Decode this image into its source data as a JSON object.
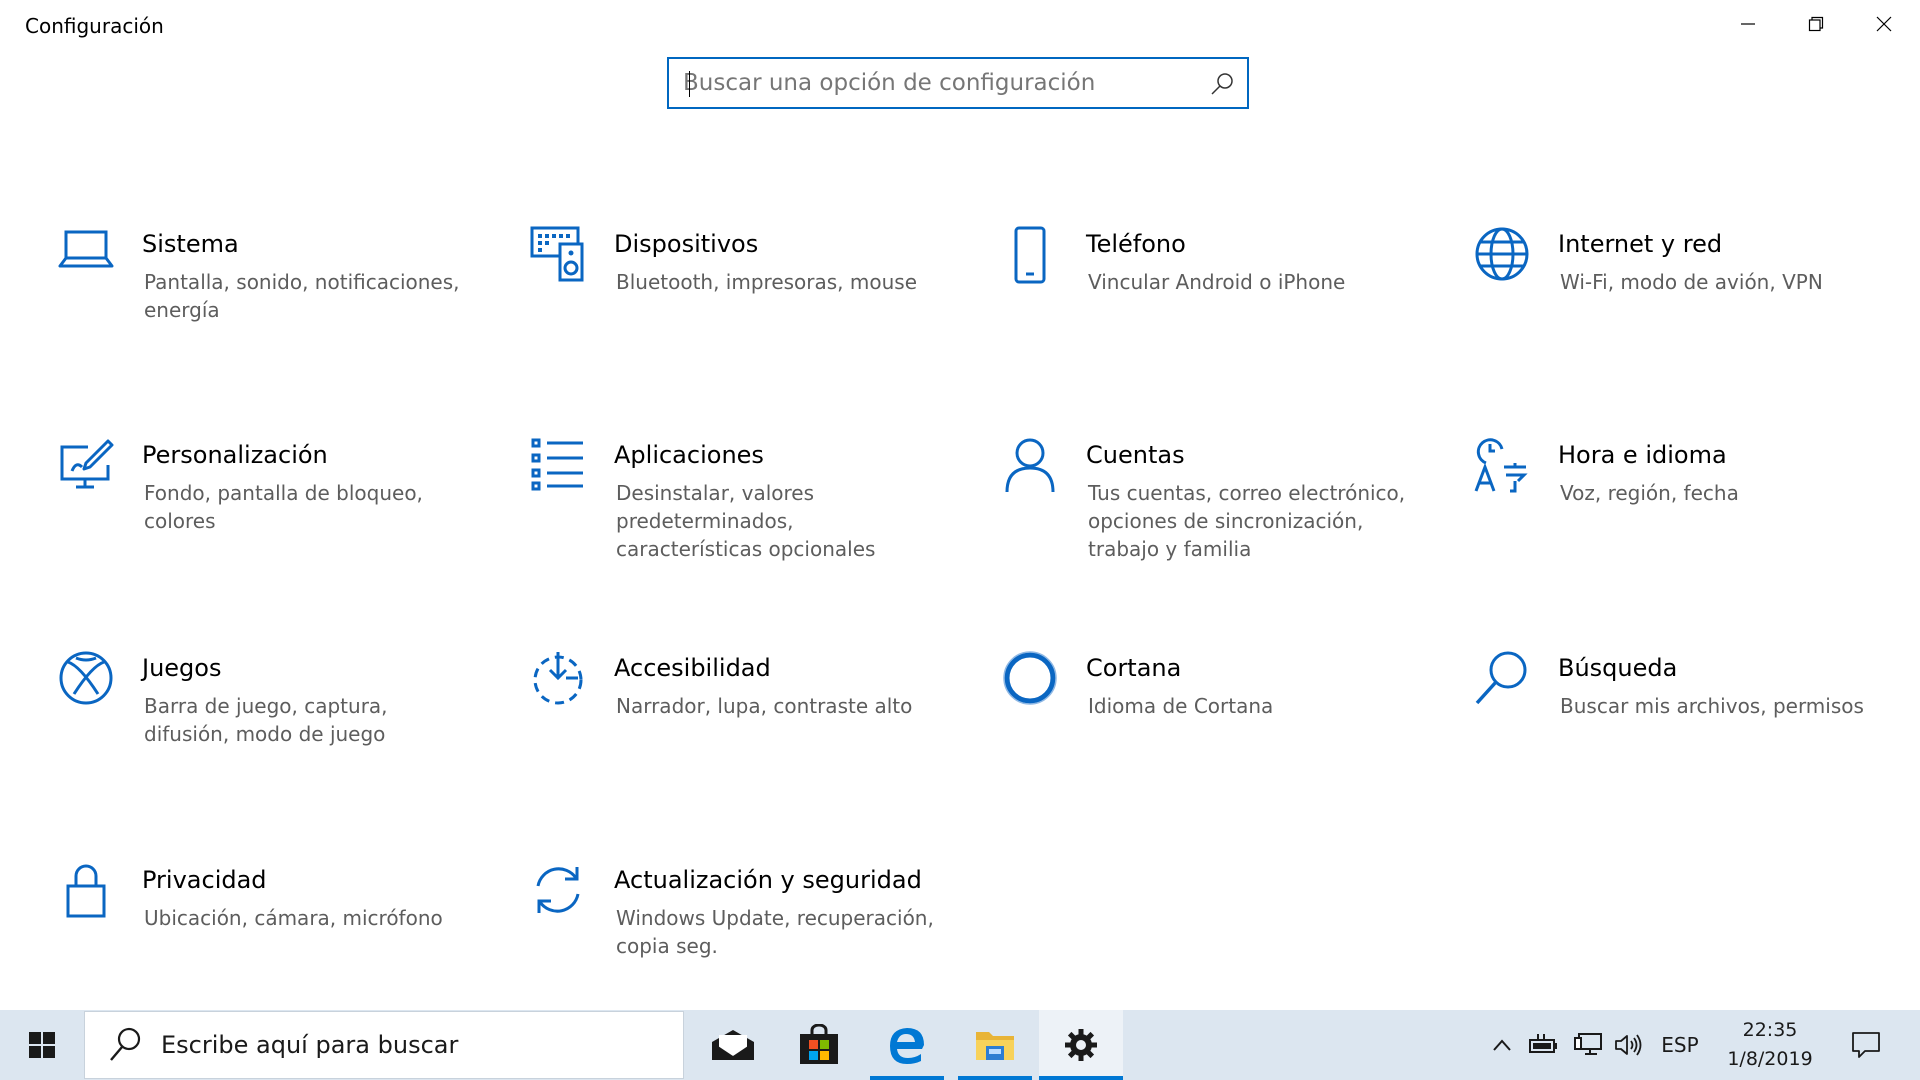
{
  "window": {
    "title": "Configuración",
    "controls": [
      "minimize-icon",
      "restore-icon",
      "close-icon"
    ]
  },
  "search": {
    "placeholder": "Buscar una opción de configuración",
    "value": "",
    "icon": "search-icon"
  },
  "colors": {
    "accent": "#0067c0",
    "icon_blue": "#0a66c2",
    "taskbar": "#dce6f0",
    "description": "#5d5d5d"
  },
  "categories": [
    {
      "title": "Sistema",
      "desc": "Pantalla, sonido, notificaciones, energía",
      "icon": "laptop-icon"
    },
    {
      "title": "Dispositivos",
      "desc": "Bluetooth, impresoras, mouse",
      "icon": "devices-icon"
    },
    {
      "title": "Teléfono",
      "desc": "Vincular Android o iPhone",
      "icon": "phone-icon"
    },
    {
      "title": "Internet y red",
      "desc": "Wi-Fi, modo de avión, VPN",
      "icon": "globe-icon"
    },
    {
      "title": "Personalización",
      "desc": "Fondo, pantalla de bloqueo, colores",
      "icon": "personalization-icon"
    },
    {
      "title": "Aplicaciones",
      "desc": "Desinstalar, valores predeterminados, características opcionales",
      "icon": "apps-list-icon"
    },
    {
      "title": "Cuentas",
      "desc": "Tus cuentas, correo electrónico, opciones de sincronización, trabajo y familia",
      "icon": "person-icon"
    },
    {
      "title": "Hora e idioma",
      "desc": "Voz, región, fecha",
      "icon": "time-language-icon"
    },
    {
      "title": "Juegos",
      "desc": "Barra de juego, captura, difusión, modo de juego",
      "icon": "xbox-icon"
    },
    {
      "title": "Accesibilidad",
      "desc": "Narrador, lupa, contraste alto",
      "icon": "accessibility-icon"
    },
    {
      "title": "Cortana",
      "desc": "Idioma de Cortana",
      "icon": "cortana-icon"
    },
    {
      "title": "Búsqueda",
      "desc": "Buscar mis archivos, permisos",
      "icon": "magnifier-icon"
    },
    {
      "title": "Privacidad",
      "desc": "Ubicación, cámara, micrófono",
      "icon": "lock-icon"
    },
    {
      "title": "Actualización y seguridad",
      "desc": "Windows Update, recuperación, copia seg.",
      "icon": "sync-icon"
    }
  ],
  "taskbar": {
    "search_text": "Escribe aquí para buscar",
    "apps": [
      "mail-icon",
      "store-icon",
      "edge-icon",
      "file-explorer-icon",
      "settings-gear-icon"
    ],
    "tray": {
      "language": "ESP",
      "time": "22:35",
      "date": "1/8/2019"
    }
  }
}
